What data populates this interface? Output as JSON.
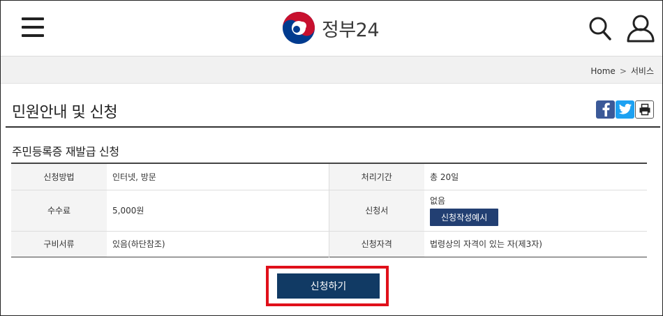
{
  "header": {
    "logo_text": "정부24",
    "menu_icon": "hamburger-menu-icon",
    "search_icon": "search-icon",
    "user_icon": "user-icon"
  },
  "breadcrumb": {
    "home": "Home",
    "separator": ">",
    "current": "서비스"
  },
  "page": {
    "title": "민원안내 및 신청"
  },
  "share": {
    "facebook_icon": "facebook-icon",
    "twitter_icon": "twitter-icon",
    "print_icon": "print-icon"
  },
  "service": {
    "title": "주민등록증 재발급 신청",
    "rows": [
      {
        "label_left": "신청방법",
        "value_left": "인터넷, 방문",
        "label_right": "처리기간",
        "value_right": "총 20일"
      },
      {
        "label_left": "수수료",
        "value_left": "5,000원",
        "label_right": "신청서",
        "value_right": "없음",
        "example_button": "신청작성예시"
      },
      {
        "label_left": "구비서류",
        "value_left": "있음(하단참조)",
        "label_right": "신청자격",
        "value_right": "법령상의 자격이 있는 자(제3자)"
      }
    ],
    "apply_label": "신청하기"
  },
  "colors": {
    "apply_button": "#113a64",
    "highlight_border": "#e0101a",
    "example_button": "#223f72",
    "facebook": "#3b5998",
    "twitter": "#1da1f2",
    "logo_red": "#c8102e",
    "logo_blue": "#003b8f"
  }
}
